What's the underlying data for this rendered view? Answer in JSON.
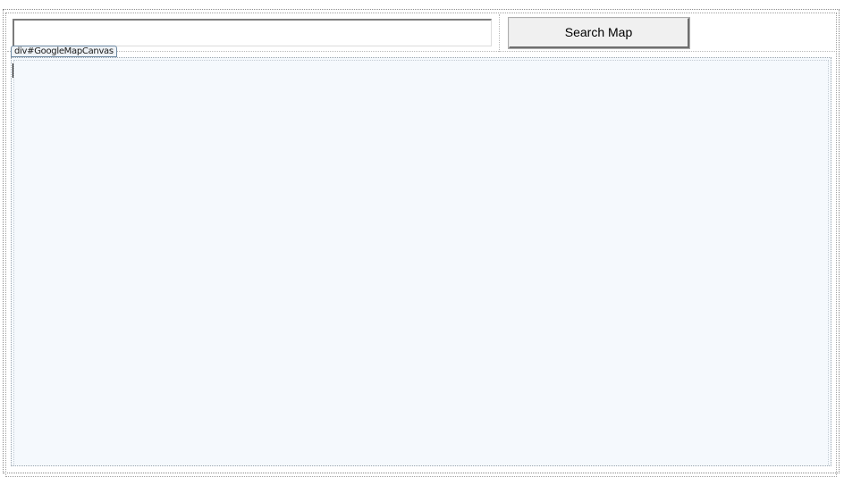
{
  "search": {
    "value": "",
    "placeholder": "",
    "button_label": "Search Map"
  },
  "map_canvas": {
    "tag_label": "div#GoogleMapCanvas"
  },
  "colors": {
    "canvas_background": "#f5f9fd",
    "button_face": "#f0f0f0",
    "tag_border": "#6f8aa3"
  }
}
